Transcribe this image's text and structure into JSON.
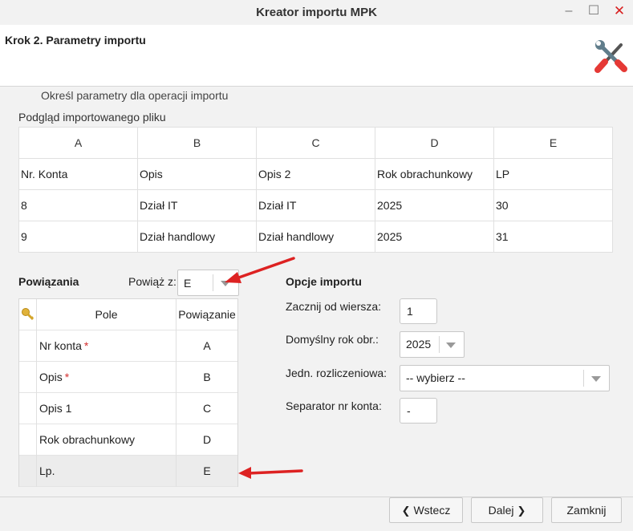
{
  "window": {
    "title": "Kreator importu MPK"
  },
  "header": {
    "step_title": "Krok 2. Parametry importu"
  },
  "subtitle": "Określ parametry dla operacji importu",
  "preview": {
    "label": "Podgląd importowanego pliku",
    "columns": [
      "A",
      "B",
      "C",
      "D",
      "E"
    ],
    "rows": [
      [
        "Nr. Konta",
        "Opis",
        "Opis 2",
        "Rok obrachunkowy",
        "LP"
      ],
      [
        "8",
        "Dział IT",
        "Dział IT",
        "2025",
        "30"
      ],
      [
        "9",
        "Dział handlowy",
        "Dział handlowy",
        "2025",
        "31"
      ]
    ]
  },
  "bindings": {
    "title": "Powiązania",
    "link_label": "Powiąż z:",
    "link_value": "E",
    "grid": {
      "col_pole": "Pole",
      "col_binding": "Powiązanie",
      "rows": [
        {
          "field": "Nr konta",
          "required": "*",
          "binding": "A"
        },
        {
          "field": "Opis",
          "required": "*",
          "binding": "B"
        },
        {
          "field": "Opis 1",
          "binding": "C"
        },
        {
          "field": "Rok obrachunkowy",
          "binding": "D"
        },
        {
          "field": "Lp.",
          "binding": "E"
        }
      ]
    }
  },
  "options": {
    "title": "Opcje importu",
    "start_row_label": "Zacznij od wiersza:",
    "start_row_value": "1",
    "default_year_label": "Domyślny rok obr.:",
    "default_year_value": "2025",
    "unit_label": "Jedn. rozliczeniowa:",
    "unit_value": "-- wybierz --",
    "separator_label": "Separator nr konta:",
    "separator_value": "-"
  },
  "footer": {
    "back_label": "Wstecz",
    "next_label": "Dalej",
    "close_label": "Zamknij"
  },
  "colors": {
    "accent_red": "#d32f2f",
    "required": "#d32f2f"
  }
}
